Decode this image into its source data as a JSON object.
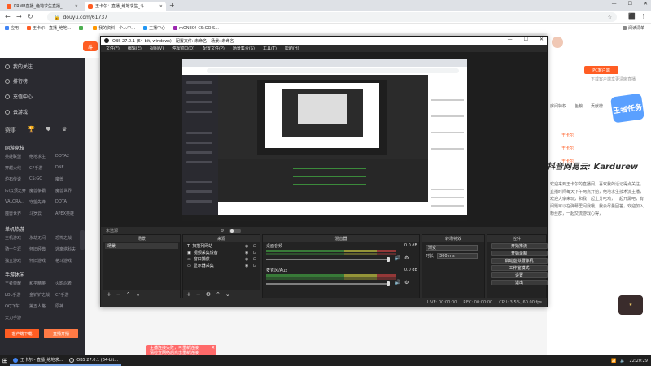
{
  "browser": {
    "tabs": [
      {
        "label": "KRMB直播_绝地求生直播_",
        "active": false,
        "color": "#ff5d23"
      },
      {
        "label": "王卡尔：直播_绝地求生_斗",
        "active": true,
        "color": "#ff5d23"
      }
    ],
    "new_tab": "+",
    "url": "douyu.com/61737",
    "bookmarks": [
      {
        "label": "应用",
        "color": "#4285f4"
      },
      {
        "label": "王卡尔：直播_绝地...",
        "color": "#ff5d23"
      },
      {
        "label": "",
        "color": "#4caf50"
      },
      {
        "label": "我的资料 - 个人中...",
        "color": "#ff9800"
      },
      {
        "label": "主播中心",
        "color": "#2196f3"
      },
      {
        "label": "mONEO! CS:GO S...",
        "color": "#9c27b0"
      }
    ],
    "bookmark_right": "阅读清单"
  },
  "sidebar": {
    "items": [
      "我的关注",
      "排行榜",
      "充值中心",
      "云游戏"
    ],
    "heads": [
      "赛事",
      "",
      ""
    ],
    "sections": [
      {
        "title": "网游竞技",
        "items": [
          "英雄联盟",
          "绝地求生",
          "DOTA2",
          "穿越火线",
          "CF手游",
          "DNF",
          "炉石传说",
          "CS:GO",
          "魔兽",
          "lol云顶之弈",
          "魔兽争霸",
          "魔兽世界",
          "VALORA...",
          "守望先锋",
          "DOTA",
          "魔兽世界",
          "斗罗云",
          "APEX英雄"
        ]
      },
      {
        "title": "单机热游",
        "items": [
          "主机游戏",
          "永劫无间",
          "恐怖之战",
          "骑士生涯",
          "怀旧经典",
          "逃离塔科夫",
          "独立游戏",
          "怀旧游戏",
          "格斗游戏"
        ]
      },
      {
        "title": "手游休闲",
        "items": [
          "王者荣耀",
          "和平精英",
          "火影忍者",
          "LOL手游",
          "金铲铲之战",
          "CF手游",
          "QQ飞车",
          "第五人格",
          "原神",
          "天刀手游"
        ]
      }
    ],
    "btn_left": "客户端下载",
    "btn_right": "直播开播"
  },
  "obs": {
    "title": "OBS 27.0.1 (64-bit, windows) - 配置文件: 未命名 - 场景: 未命名",
    "menu": [
      "文件(F)",
      "编辑(E)",
      "视图(V)",
      "停靠窗口(D)",
      "配置文件(P)",
      "场景集合(S)",
      "工具(T)",
      "帮助(H)"
    ],
    "status_label": "未选源",
    "dock_titles": {
      "scenes": "场景",
      "sources": "来源",
      "mixer": "混音器",
      "transitions": "转场特效",
      "controls": "控件"
    },
    "scenes": [
      "场景"
    ],
    "sources": [
      "扫描列网站",
      "视频采集设备",
      "窗口捕获",
      "显示器采集"
    ],
    "mixer": [
      {
        "name": "桌面音频",
        "db": "0.0 dB"
      },
      {
        "name": "麦克风/Aux",
        "db": "0.0 dB"
      }
    ],
    "transition": {
      "type": "渐变",
      "duration_label": "时长",
      "duration": "300 ms"
    },
    "controls": [
      "开始推流",
      "开始录制",
      "启动虚拟摄像机",
      "工作室模式",
      "设置",
      "退出"
    ],
    "bottom": [
      "LIVE: 00:00:00",
      "REC: 00:00:00",
      "CPU: 3.5%, 60.00 fps"
    ]
  },
  "right": {
    "pc_button": "PC客户端",
    "pc_sub": "下载客户端享更清晰直播",
    "tabs": [
      "房间特权",
      "鱼粮",
      "贡献榜",
      "粉丝团"
    ],
    "badge": "王者任务",
    "gifts": [
      "王卡尔",
      "王卡尔",
      "王卡尔"
    ],
    "watermark": "抖音网易云: Kardurew",
    "desc": "欢迎来到王卡尔的直播间，喜欢我的话记得点关注，直播时间每天下午两点开始，绝地求生技术流主播，欢迎大家来玩，和我一起上分吃鸡，一起开黑吧，有问题可以在弹幕里问我哦，我会尽量回答，欢迎加入粉丝群，一起交流游戏心得，"
  },
  "popup": {
    "line1": "主播连接失败，可重新连接",
    "line2": "请检查网络后点击重新连接"
  },
  "taskbar": {
    "tasks": [
      {
        "label": "王卡尔 - 直播_绝地求...",
        "color": "#4285f4"
      },
      {
        "label": "OBS 27.0.1 (64-bit...",
        "color": "#333333"
      }
    ],
    "time": "22:20:29"
  }
}
